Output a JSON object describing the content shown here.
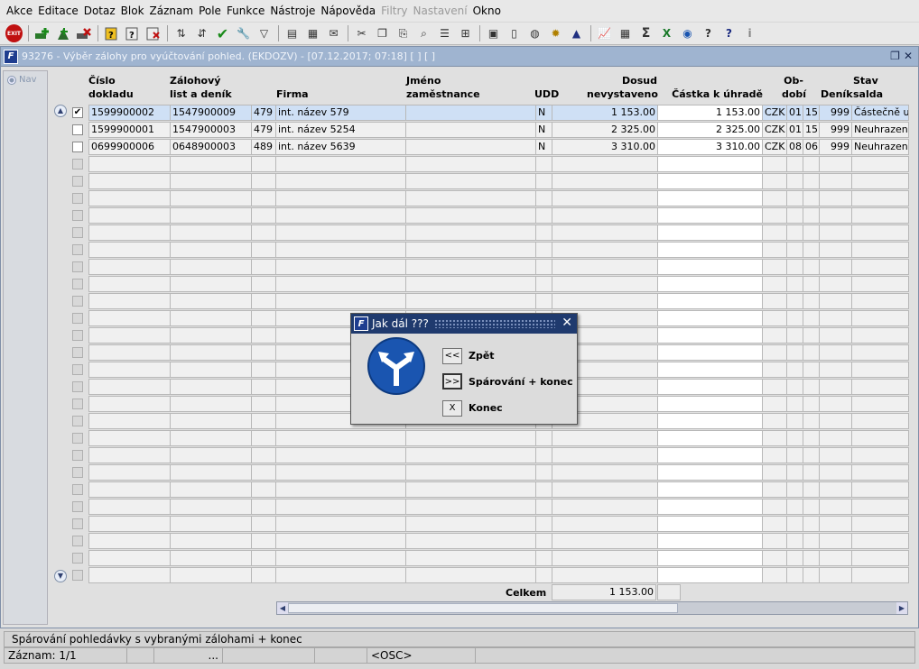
{
  "menu": [
    "Akce",
    "Editace",
    "Dotaz",
    "Blok",
    "Záznam",
    "Pole",
    "Funkce",
    "Nástroje",
    "Nápověda",
    "Filtry",
    "Nastavení",
    "Okno"
  ],
  "menu_disabled": [
    "Filtry",
    "Nastavení"
  ],
  "toolbar_exit": "EXIT",
  "window": {
    "title": "93276 - Výběr zálohy pro vyúčtování pohled. (EKDOZV) - [07.12.2017; 07:18]  [ ] [ ]",
    "nav_label": "Nav"
  },
  "columns": {
    "cislo": "Číslo\ndokladu",
    "zalohovy": "Zálohový\nlist a deník",
    "firma": "Firma",
    "jmeno": "Jméno\nzaměstnance",
    "udd": "UDD",
    "dosud": "Dosud\nnevystaveno",
    "castka": "Částka k úhradě",
    "obdobi": "Ob-\ndobí",
    "denik": "Deník",
    "stav": "Stav\nsalda"
  },
  "rows": [
    {
      "checked": true,
      "cislo": "1599900002",
      "zalohovy": "1547900009",
      "kod": "479",
      "firma": "int. název 579",
      "jmeno": "",
      "udd": "N",
      "dosud": "1 153.00",
      "castka": "1 153.00",
      "mena": "CZK",
      "obd1": "01",
      "obd2": "15",
      "denik": "999",
      "stav": "Částečně uh"
    },
    {
      "checked": false,
      "cislo": "1599900001",
      "zalohovy": "1547900003",
      "kod": "479",
      "firma": "int. název 5254",
      "jmeno": "",
      "udd": "N",
      "dosud": "2 325.00",
      "castka": "2 325.00",
      "mena": "CZK",
      "obd1": "01",
      "obd2": "15",
      "denik": "999",
      "stav": "Neuhrazené"
    },
    {
      "checked": false,
      "cislo": "0699900006",
      "zalohovy": "0648900003",
      "kod": "489",
      "firma": "int. název 5639",
      "jmeno": "",
      "udd": "N",
      "dosud": "3 310.00",
      "castka": "3 310.00",
      "mena": "CZK",
      "obd1": "08",
      "obd2": "06",
      "denik": "999",
      "stav": "Neuhrazené"
    }
  ],
  "totals": {
    "label": "Celkem",
    "value": "1 153.00"
  },
  "dialog": {
    "title": "Jak dál ???",
    "back_btn": "<<",
    "back_label": "Zpět",
    "match_btn": ">>",
    "match_label": "Spárování + konec",
    "end_btn": "X",
    "end_label": "Konec"
  },
  "status": {
    "hint": "Spárování pohledávky s vybranými zálohami + konec",
    "record": "Záznam: 1/1",
    "seg3": "...",
    "mode": "<OSC>"
  }
}
